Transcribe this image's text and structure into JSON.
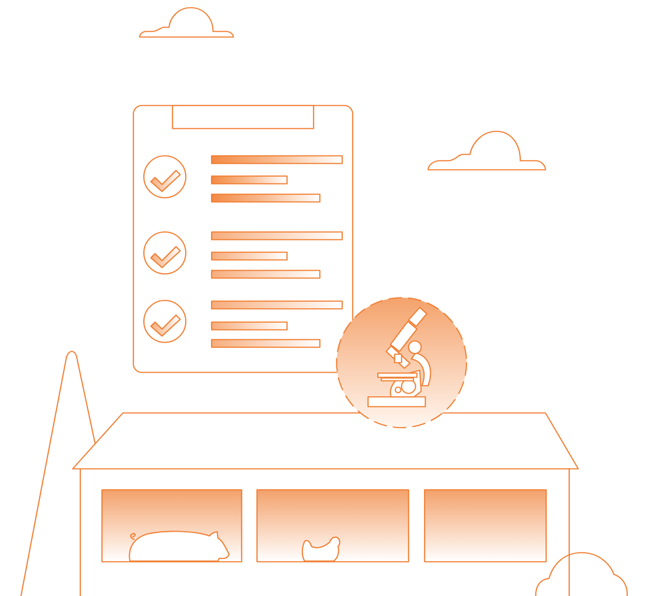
{
  "palette": {
    "stroke": "#f07a2b",
    "fill_strong": "#f3a46f",
    "fill_light": "#ffffff"
  },
  "clipboard": {
    "items": [
      {
        "checked": true,
        "bars": 3
      },
      {
        "checked": true,
        "bars": 3
      },
      {
        "checked": true,
        "bars": 3
      }
    ]
  },
  "icons": [
    "cloud-icon",
    "clipboard-icon",
    "checkmark-icon",
    "microscope-icon",
    "barn-icon",
    "pig-icon",
    "chicken-icon",
    "silo-icon"
  ]
}
